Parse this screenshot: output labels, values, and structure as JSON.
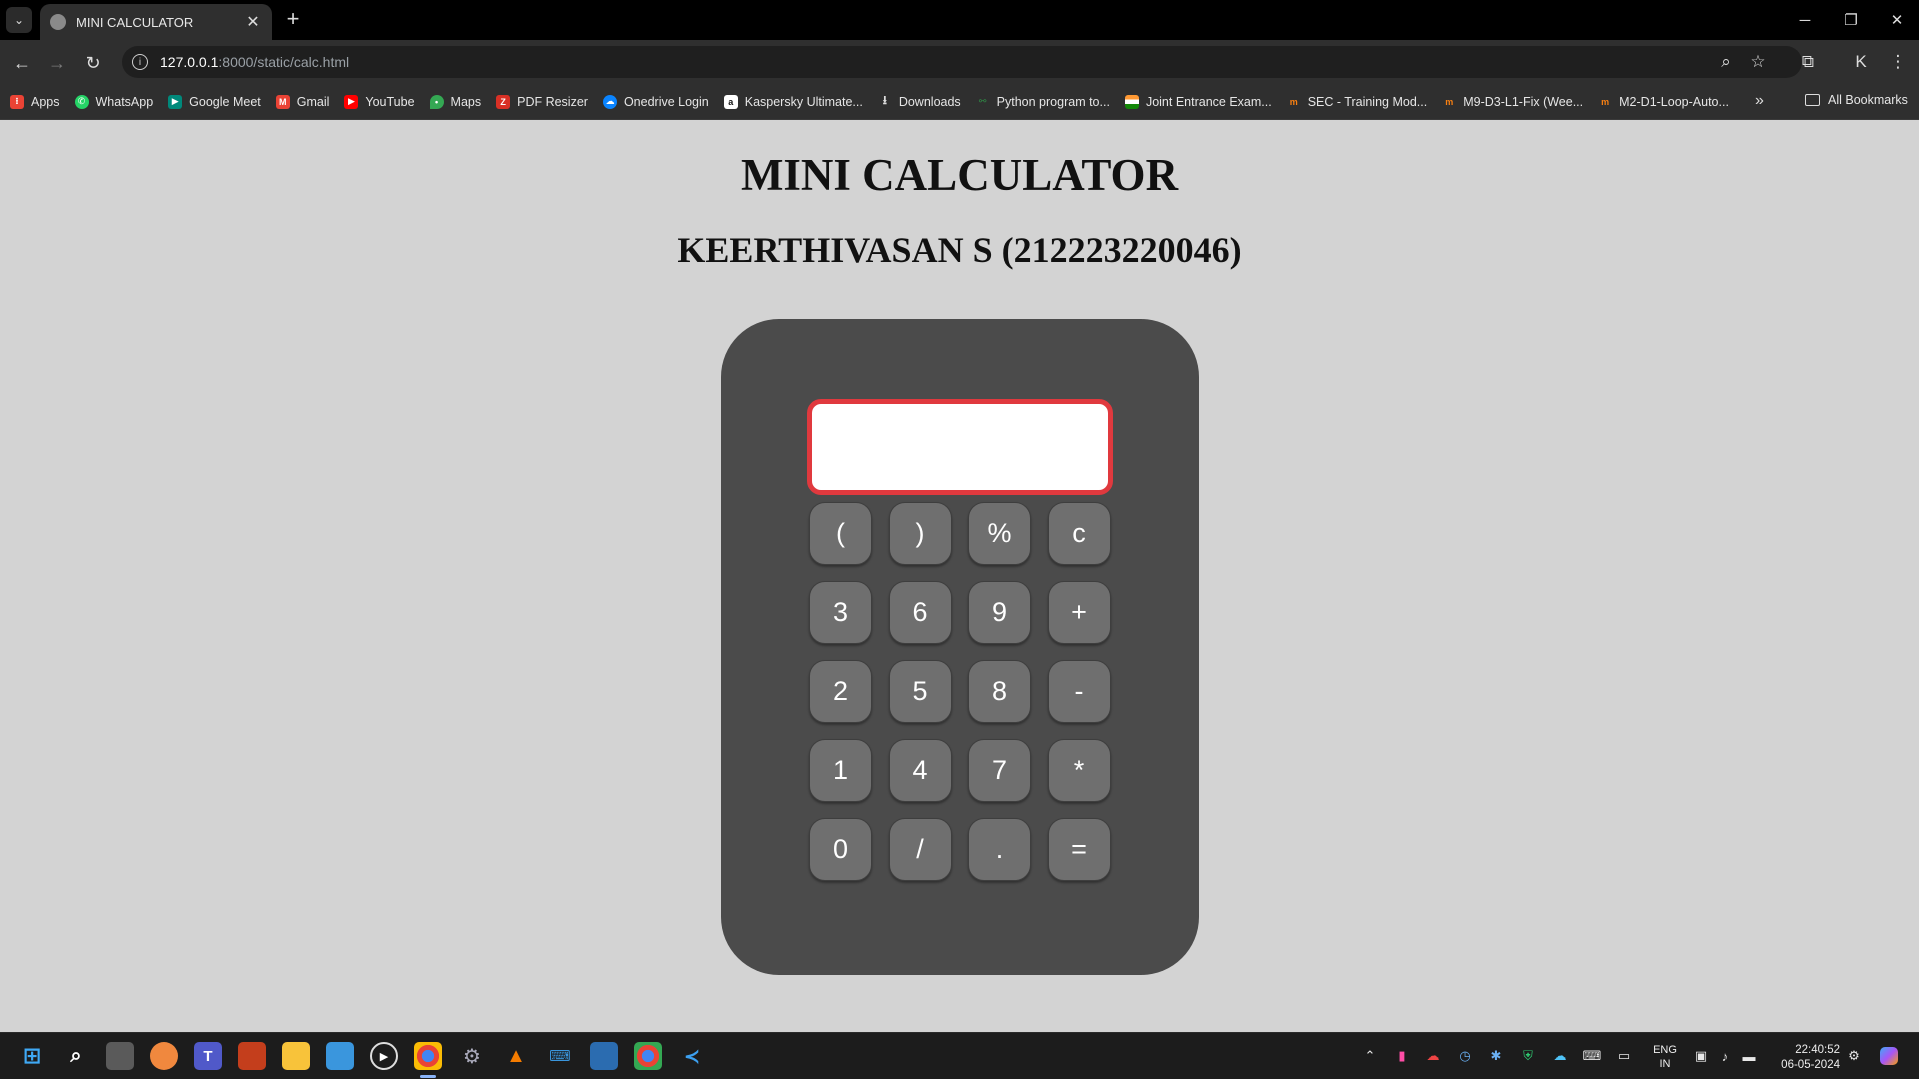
{
  "browser": {
    "tab": {
      "title": "MINI CALCULATOR",
      "close": "✕"
    },
    "new_tab": "+",
    "window_controls": {
      "minimize": "─",
      "restore": "❐",
      "close": "✕"
    },
    "address": {
      "host": "127.0.0.1",
      "path": ":8000/static/calc.html"
    },
    "bookmarks": [
      {
        "label": "Apps",
        "icon": "apps-grid-icon",
        "color": "#ea4335"
      },
      {
        "label": "WhatsApp",
        "icon": "whatsapp-icon",
        "color": "#25d366"
      },
      {
        "label": "Google Meet",
        "icon": "google-meet-icon",
        "color": "#00897b"
      },
      {
        "label": "Gmail",
        "icon": "gmail-icon",
        "color": "#ea4335"
      },
      {
        "label": "YouTube",
        "icon": "youtube-icon",
        "color": "#ff0000"
      },
      {
        "label": "Maps",
        "icon": "maps-icon",
        "color": "#34a853"
      },
      {
        "label": "PDF Resizer",
        "icon": "pdf-icon",
        "color": "#d93025"
      },
      {
        "label": "Onedrive Login",
        "icon": "onedrive-icon",
        "color": "#0a84ff"
      },
      {
        "label": "Kaspersky Ultimate...",
        "icon": "amazon-icon",
        "color": "#ffffff"
      },
      {
        "label": "Downloads",
        "icon": "download-icon",
        "color": "#5f6368"
      },
      {
        "label": "Python program to...",
        "icon": "gfg-icon",
        "color": "#2f8d46"
      },
      {
        "label": "Joint Entrance Exam...",
        "icon": "india-flag-icon",
        "color": "#ff9933"
      },
      {
        "label": "SEC - Training Mod...",
        "icon": "moodle-icon",
        "color": "#f98012"
      },
      {
        "label": "M9-D3-L1-Fix (Wee...",
        "icon": "moodle-icon",
        "color": "#f98012"
      },
      {
        "label": "M2-D1-Loop-Auto...",
        "icon": "moodle-icon",
        "color": "#f98012"
      }
    ],
    "all_bookmarks": "All Bookmarks"
  },
  "page": {
    "title": "MINI CALCULATOR",
    "subtitle": "KEERTHIVASAN S (212223220046)",
    "display_value": "",
    "keys": [
      "(",
      ")",
      "%",
      "c",
      "3",
      "6",
      "9",
      "+",
      "2",
      "5",
      "8",
      "-",
      "1",
      "4",
      "7",
      "*",
      "0",
      "/",
      ".",
      "="
    ],
    "colors": {
      "background": "#d3d3d3",
      "body": "#4b4b4b",
      "key": "#6f6f6f",
      "display_border": "#e0393e"
    }
  },
  "taskbar": {
    "language": {
      "line1": "ENG",
      "line2": "IN"
    },
    "clock": {
      "time": "22:40:52",
      "date": "06-05-2024"
    }
  }
}
